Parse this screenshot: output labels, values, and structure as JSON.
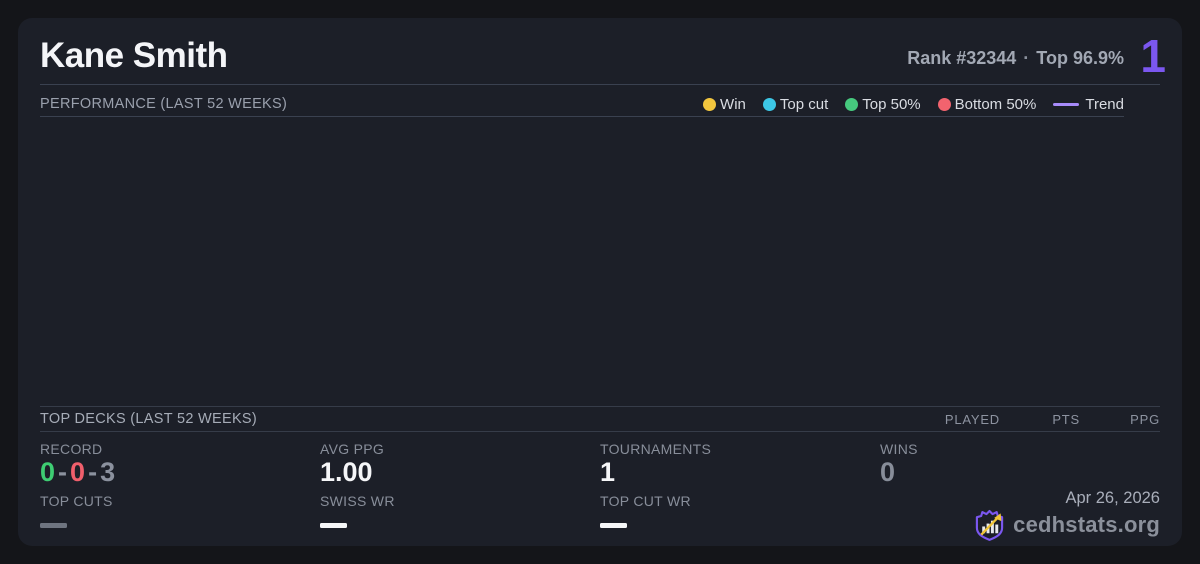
{
  "header": {
    "player_name": "Kane Smith",
    "rank_text": "Rank #32344",
    "separator": "·",
    "top_percent_text": "Top 96.9%",
    "count_badge": "1"
  },
  "performance": {
    "title": "PERFORMANCE (LAST 52 WEEKS)",
    "legend": [
      {
        "label": "Win",
        "color": "#f2c63e"
      },
      {
        "label": "Top cut",
        "color": "#3cc7e6"
      },
      {
        "label": "Top 50%",
        "color": "#46c97e"
      },
      {
        "label": "Bottom 50%",
        "color": "#f2636e"
      },
      {
        "label": "Trend",
        "color": "#a78bfa",
        "swatch": "line"
      }
    ]
  },
  "chart_data": {
    "type": "scatter",
    "title": "PERFORMANCE (LAST 52 WEEKS)",
    "x_range": "last 52 weeks",
    "points": [],
    "series_visible": []
  },
  "top_decks": {
    "title": "TOP DECKS (LAST 52 WEEKS)",
    "columns": [
      "PLAYED",
      "PTS",
      "PPG"
    ],
    "rows": []
  },
  "stats": {
    "record": {
      "label": "RECORD",
      "wins": "0",
      "losses": "0",
      "draws": "3",
      "separator": "-"
    },
    "top_cuts": {
      "label": "TOP CUTS",
      "value": "—"
    },
    "avg_ppg": {
      "label": "AVG PPG",
      "value": "1.00"
    },
    "swiss_wr": {
      "label": "SWISS WR",
      "value": "—"
    },
    "tournaments": {
      "label": "TOURNAMENTS",
      "value": "1"
    },
    "top_cut_wr": {
      "label": "TOP CUT WR",
      "value": "—"
    },
    "wins": {
      "label": "WINS",
      "value": "0"
    }
  },
  "footer": {
    "date": "Apr 26, 2026",
    "brand": "cedhstats.org"
  },
  "colors": {
    "page_bg": "#141519",
    "card_bg": "#1c1f28",
    "accent_purple": "#7b57f0",
    "trend_purple": "#a78bfa",
    "win_yellow": "#f2c63e",
    "top_cut_cyan": "#3cc7e6",
    "top50_green": "#46c97e",
    "bottom50_red": "#f2636e",
    "record_green": "#3ecd73",
    "record_red": "#f05f6c",
    "muted_gray": "#8b919e",
    "value_white": "#f5f6f8"
  }
}
